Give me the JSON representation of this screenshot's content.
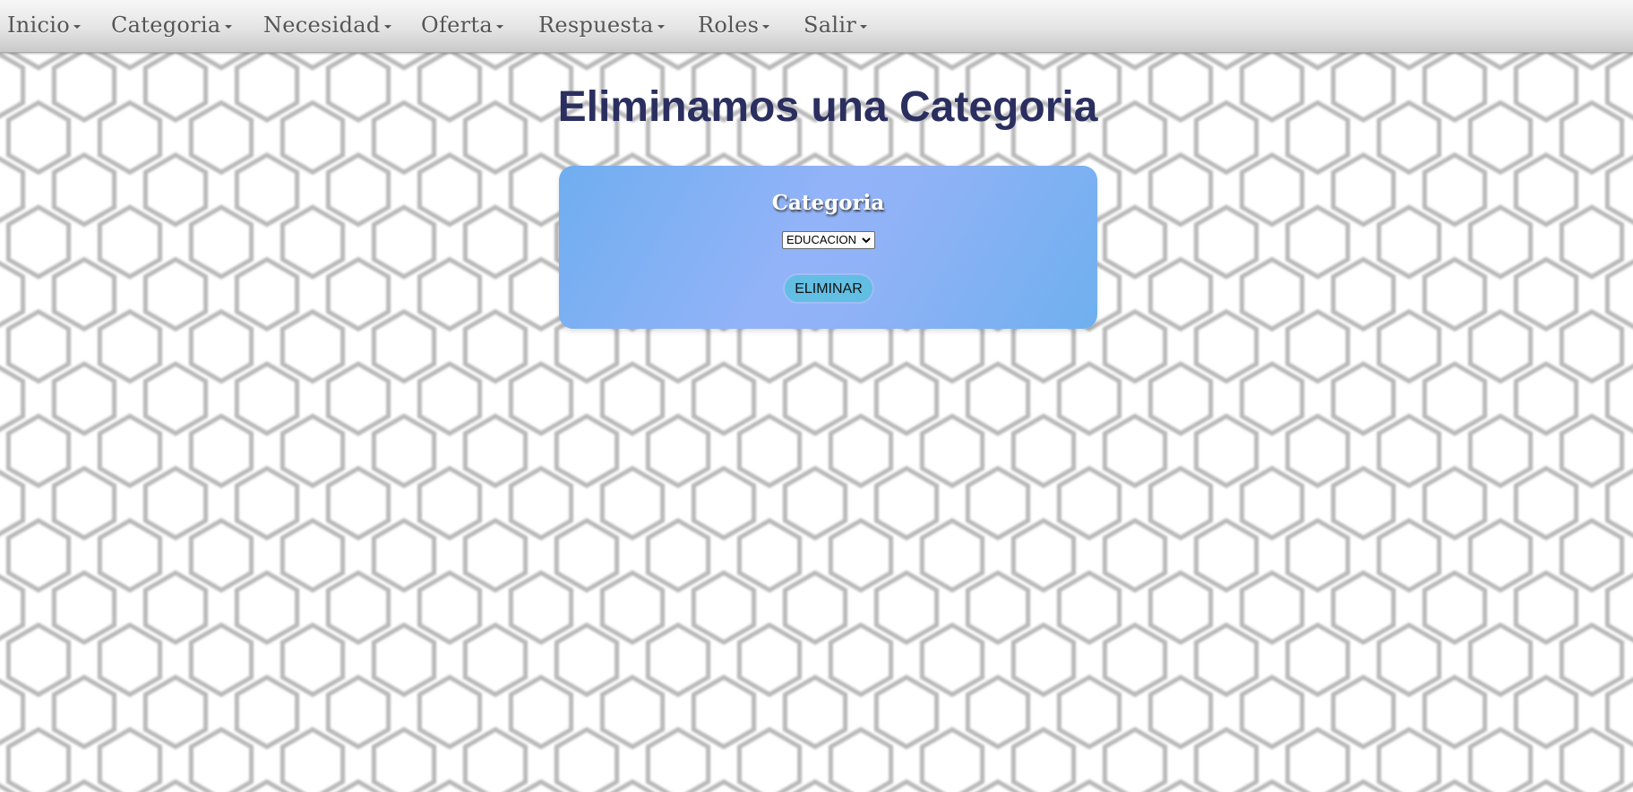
{
  "nav": {
    "items": [
      {
        "label": "Inicio"
      },
      {
        "label": "Categoria"
      },
      {
        "label": "Necesidad"
      },
      {
        "label": "Oferta"
      },
      {
        "label": "Respuesta"
      },
      {
        "label": "Roles"
      },
      {
        "label": "Salir"
      }
    ]
  },
  "page": {
    "title": "Eliminamos una Categoria"
  },
  "form": {
    "field_label": "Categoria",
    "select_value": "EDUCACION",
    "delete_label": "ELIMINAR"
  },
  "colors": {
    "title": "#2b2f5f",
    "card_start": "#6faef0",
    "card_mid": "#93b3f8",
    "button": "#62bfe3",
    "nav_text": "#555555"
  },
  "icons": {
    "nav_caret": "caret-down-icon",
    "select_chevron": "chevron-down-icon",
    "background": "hexagon-pattern"
  }
}
